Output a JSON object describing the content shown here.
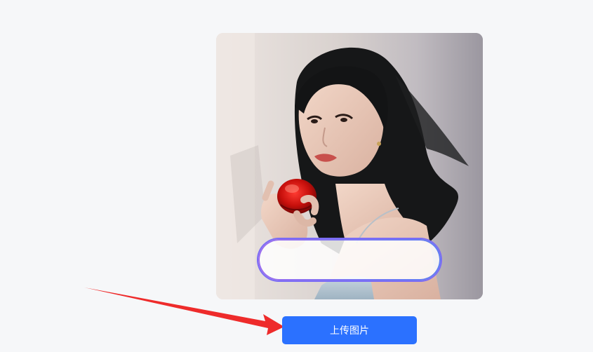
{
  "upload": {
    "label": "上传图片"
  },
  "photo": {
    "subject_icon": "portrait-photo"
  },
  "caption": {
    "text": ""
  },
  "annotation": {
    "arrow_icon": "red-arrow",
    "color": "#ee2b2b"
  },
  "colors": {
    "accent": "#2b71ff",
    "page_background": "#f6f7f9"
  }
}
